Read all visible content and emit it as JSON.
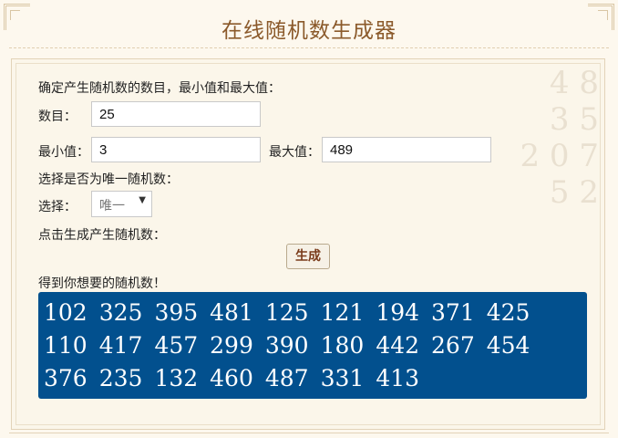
{
  "title": "在线随机数生成器",
  "form": {
    "intro": "确定产生随机数的数目，最小值和最大值：",
    "count_label": "数目：",
    "count_value": "25",
    "min_label": "最小值：",
    "min_value": "3",
    "max_label": "最大值：",
    "max_value": "489",
    "unique_prompt": "选择是否为唯一随机数：",
    "choose_label": "选择：",
    "choose_value": "唯一",
    "click_prompt": "点击生成产生随机数：",
    "generate_label": "生成",
    "result_label": "得到你想要的随机数！"
  },
  "results": [
    "102",
    "325",
    "395",
    "481",
    "125",
    "121",
    "194",
    "371",
    "425",
    "110",
    "417",
    "457",
    "299",
    "390",
    "180",
    "442",
    "267",
    "454",
    "376",
    "235",
    "132",
    "460",
    "487",
    "331",
    "413"
  ],
  "colors": {
    "title": "#8b5a2b",
    "result_bg": "#02508e",
    "page_bg": "#fdf8ee"
  }
}
